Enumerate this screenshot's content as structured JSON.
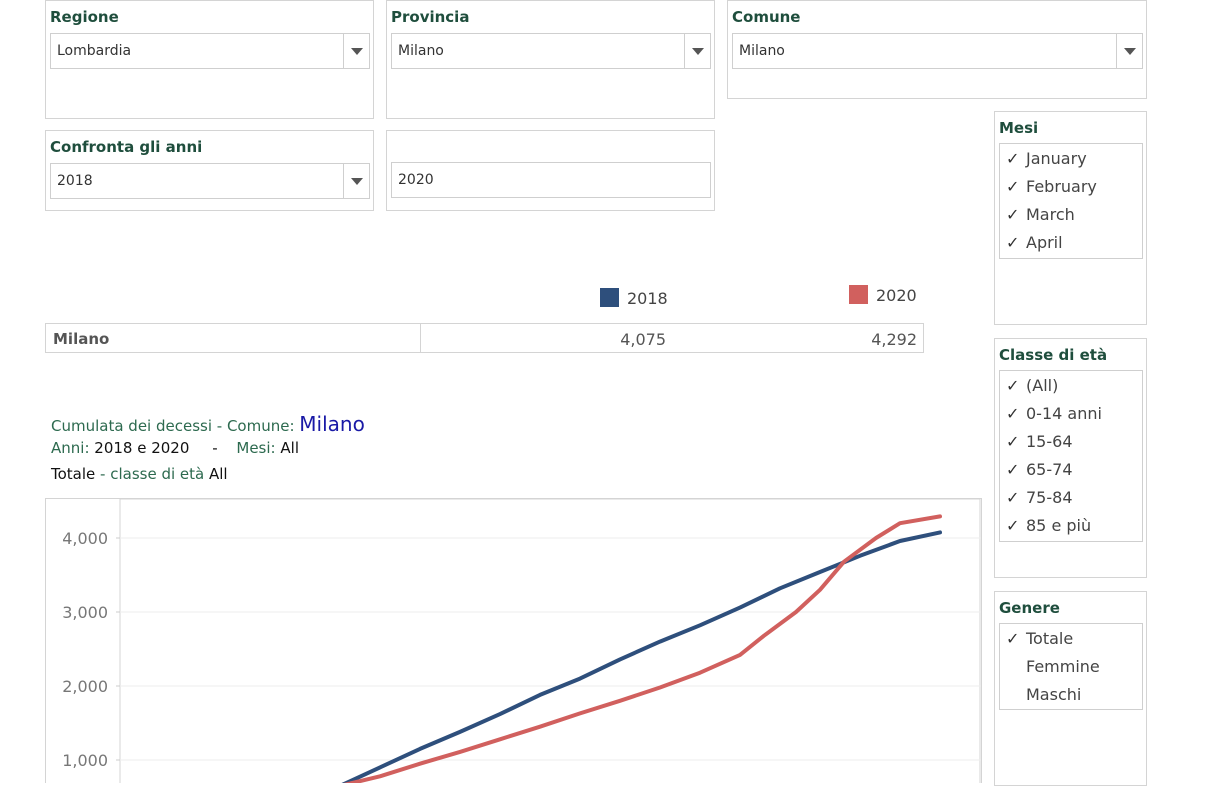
{
  "filters": {
    "regione": {
      "title": "Regione",
      "value": "Lombardia"
    },
    "provincia": {
      "title": "Provincia",
      "value": "Milano"
    },
    "comune": {
      "title": "Comune",
      "value": "Milano"
    },
    "anni": {
      "title": "Confronta gli anni",
      "value1": "2018",
      "value2": "2020"
    }
  },
  "mesi": {
    "title": "Mesi",
    "items": [
      {
        "label": "January",
        "check": "✓"
      },
      {
        "label": "February",
        "check": "✓"
      },
      {
        "label": "March",
        "check": "✓"
      },
      {
        "label": "April",
        "check": "✓"
      }
    ]
  },
  "classe": {
    "title": "Classe di età",
    "items": [
      {
        "label": "(All)",
        "check": "✓"
      },
      {
        "label": "0-14 anni",
        "check": "✓"
      },
      {
        "label": "15-64",
        "check": "✓"
      },
      {
        "label": "65-74",
        "check": "✓"
      },
      {
        "label": "75-84",
        "check": "✓"
      },
      {
        "label": "85 e più",
        "check": "✓"
      }
    ]
  },
  "genere": {
    "title": "Genere",
    "items": [
      {
        "label": "Totale",
        "check": "✓"
      },
      {
        "label": "Femmine",
        "check": ""
      },
      {
        "label": "Maschi",
        "check": ""
      }
    ]
  },
  "legend": [
    {
      "label": "2018",
      "color": "#2e4f7c"
    },
    {
      "label": "2020",
      "color": "#d1605e"
    }
  ],
  "summary": {
    "row_label": "Milano",
    "v2018": "4,075",
    "v2020": "4,292"
  },
  "subtitle": {
    "line1_prefix": "Cumulata dei decessi -  Comune:",
    "line1_city": "Milano",
    "line2_anni_label": "Anni:",
    "line2_anni_val": "2018 e 2020",
    "line2_sep": "-",
    "line2_mesi_label": "Mesi:",
    "line2_mesi_val": "All",
    "line3_totale": "Totale",
    "line3_sep": " - ",
    "line3_classe_label": "classe di età",
    "line3_classe_val": "All"
  },
  "chart_data": {
    "type": "line",
    "ylim": [
      0,
      4400
    ],
    "yticks": [
      1000,
      2000,
      3000,
      4000
    ],
    "ytick_labels": [
      "1,000",
      "2,000",
      "3,000",
      "4,000"
    ],
    "series": [
      {
        "name": "2018",
        "color": "#2e4f7c",
        "points": [
          [
            0.25,
            650
          ],
          [
            0.3,
            900
          ],
          [
            0.35,
            1150
          ],
          [
            0.4,
            1380
          ],
          [
            0.45,
            1620
          ],
          [
            0.5,
            1880
          ],
          [
            0.55,
            2100
          ],
          [
            0.6,
            2360
          ],
          [
            0.65,
            2600
          ],
          [
            0.7,
            2820
          ],
          [
            0.75,
            3060
          ],
          [
            0.8,
            3320
          ],
          [
            0.85,
            3540
          ],
          [
            0.9,
            3760
          ],
          [
            0.95,
            3960
          ],
          [
            1.0,
            4075
          ]
        ]
      },
      {
        "name": "2020",
        "color": "#d1605e",
        "points": [
          [
            0.25,
            650
          ],
          [
            0.3,
            780
          ],
          [
            0.35,
            950
          ],
          [
            0.4,
            1110
          ],
          [
            0.45,
            1280
          ],
          [
            0.5,
            1450
          ],
          [
            0.55,
            1630
          ],
          [
            0.6,
            1800
          ],
          [
            0.65,
            1980
          ],
          [
            0.7,
            2180
          ],
          [
            0.75,
            2420
          ],
          [
            0.78,
            2680
          ],
          [
            0.82,
            3000
          ],
          [
            0.85,
            3300
          ],
          [
            0.88,
            3680
          ],
          [
            0.92,
            4000
          ],
          [
            0.95,
            4200
          ],
          [
            1.0,
            4292
          ]
        ]
      }
    ]
  }
}
